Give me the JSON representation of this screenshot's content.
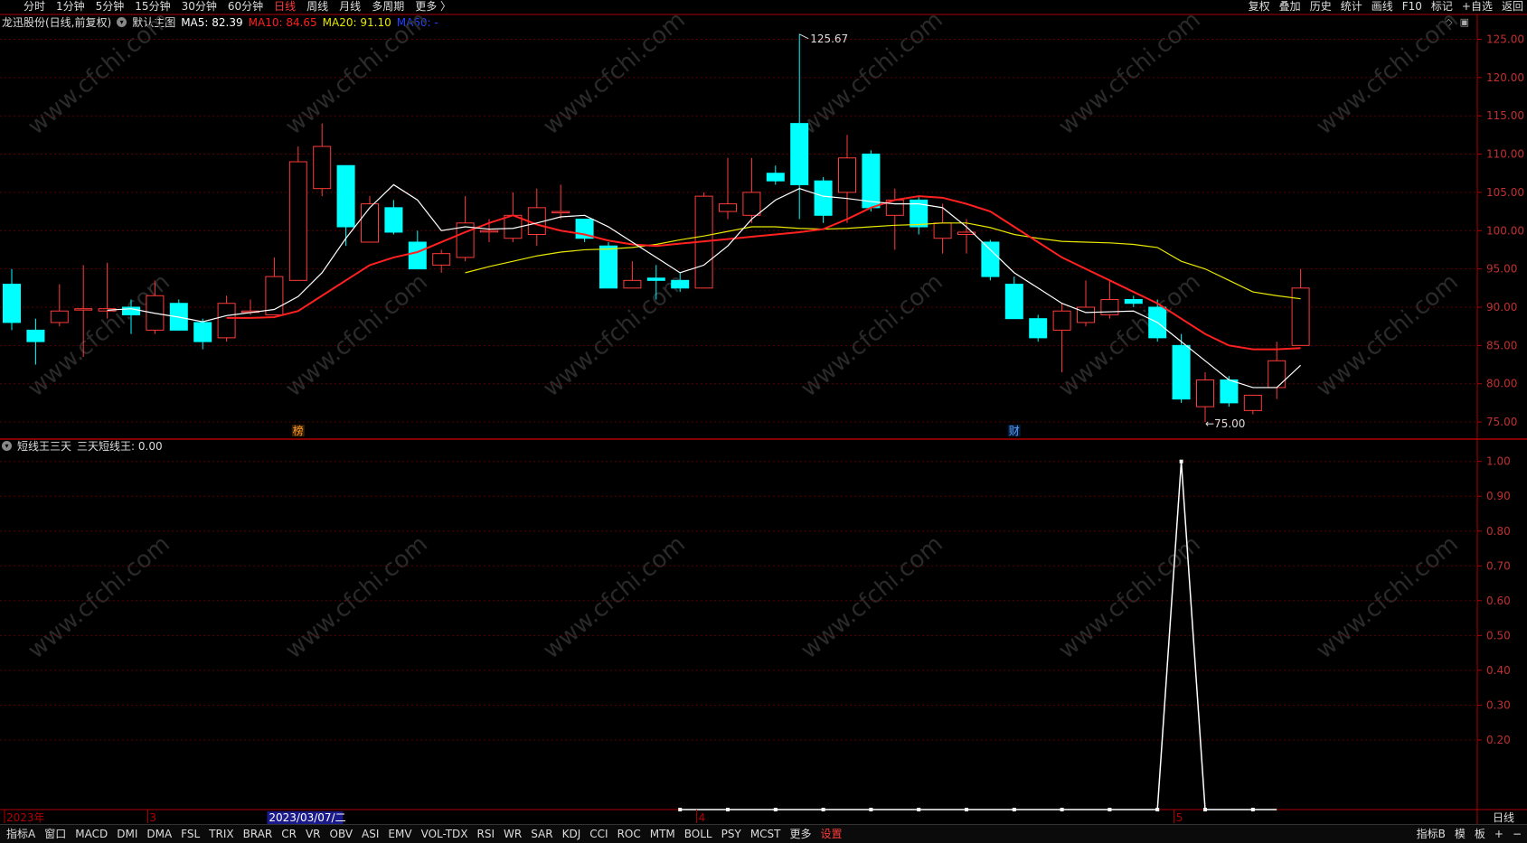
{
  "top_periods": [
    "分时",
    "1分钟",
    "5分钟",
    "15分钟",
    "30分钟",
    "60分钟",
    "日线",
    "周线",
    "月线",
    "多周期",
    "更多 〉"
  ],
  "active_period_index": 6,
  "top_tools": [
    "复权",
    "叠加",
    "历史",
    "统计",
    "画线",
    "F10",
    "标记",
    "+自选",
    "返回"
  ],
  "main_info": {
    "stock": "龙迅股份(日线,前复权)",
    "mode": "默认主图",
    "ma5": "MA5: 82.39",
    "ma10": "MA10: 84.65",
    "ma20": "MA20: 91.10",
    "ma60": "MA60: -"
  },
  "sub_info": {
    "name": "短线王三天",
    "value": "三天短线王: 0.00"
  },
  "colors": {
    "up": "#ff3b3b",
    "down": "#00ffff",
    "ma5": "#ffffff",
    "ma10": "#ff2020",
    "ma20": "#e8e800",
    "ma60": "#2244ff",
    "grid": "#5a0000",
    "axis": "#b00000"
  },
  "chart_data": [
    {
      "type": "candlestick",
      "ylim": [
        73,
        126
      ],
      "y_ticks": [
        "125.00",
        "120.00",
        "115.00",
        "110.00",
        "105.00",
        "100.00",
        "95.00",
        "90.00",
        "85.00",
        "80.00",
        "75.00"
      ],
      "candles": [
        {
          "o": 93.0,
          "h": 95.0,
          "l": 87.0,
          "c": 88.0
        },
        {
          "o": 87.0,
          "h": 88.5,
          "l": 82.5,
          "c": 85.5
        },
        {
          "o": 88.0,
          "h": 93.0,
          "l": 87.5,
          "c": 89.5
        },
        {
          "o": 89.8,
          "h": 95.5,
          "l": 83.5,
          "c": 89.8
        },
        {
          "o": 89.5,
          "h": 95.8,
          "l": 88.5,
          "c": 89.8
        },
        {
          "o": 90.0,
          "h": 91.0,
          "l": 86.5,
          "c": 89.0
        },
        {
          "o": 87.0,
          "h": 93.5,
          "l": 86.5,
          "c": 91.5
        },
        {
          "o": 90.5,
          "h": 91.0,
          "l": 87.0,
          "c": 87.0
        },
        {
          "o": 88.0,
          "h": 88.5,
          "l": 84.5,
          "c": 85.5
        },
        {
          "o": 86.0,
          "h": 91.5,
          "l": 85.5,
          "c": 90.5
        },
        {
          "o": 89.5,
          "h": 91.0,
          "l": 89.0,
          "c": 89.5
        },
        {
          "o": 89.0,
          "h": 96.5,
          "l": 89.0,
          "c": 94.0
        },
        {
          "o": 93.5,
          "h": 111.0,
          "l": 93.5,
          "c": 109.0
        },
        {
          "o": 105.5,
          "h": 114.0,
          "l": 104.5,
          "c": 111.0
        },
        {
          "o": 108.5,
          "h": 108.5,
          "l": 98.0,
          "c": 100.5
        },
        {
          "o": 98.5,
          "h": 104.5,
          "l": 98.5,
          "c": 103.5
        },
        {
          "o": 103.0,
          "h": 104.0,
          "l": 99.5,
          "c": 99.8
        },
        {
          "o": 98.5,
          "h": 100.0,
          "l": 95.0,
          "c": 95.0
        },
        {
          "o": 95.5,
          "h": 97.5,
          "l": 94.5,
          "c": 97.0
        },
        {
          "o": 96.5,
          "h": 104.5,
          "l": 96.0,
          "c": 101.0
        },
        {
          "o": 100.0,
          "h": 101.5,
          "l": 98.5,
          "c": 100.0
        },
        {
          "o": 99.0,
          "h": 105.0,
          "l": 98.5,
          "c": 102.0
        },
        {
          "o": 99.5,
          "h": 105.5,
          "l": 98.0,
          "c": 103.0
        },
        {
          "o": 102.5,
          "h": 106.0,
          "l": 101.5,
          "c": 102.5
        },
        {
          "o": 101.5,
          "h": 101.5,
          "l": 98.5,
          "c": 99.0
        },
        {
          "o": 98.0,
          "h": 98.5,
          "l": 92.5,
          "c": 92.5
        },
        {
          "o": 92.5,
          "h": 96.0,
          "l": 92.5,
          "c": 93.5
        },
        {
          "o": 93.8,
          "h": 95.5,
          "l": 91.0,
          "c": 93.5
        },
        {
          "o": 93.5,
          "h": 94.5,
          "l": 92.0,
          "c": 92.5
        },
        {
          "o": 92.5,
          "h": 105.0,
          "l": 92.5,
          "c": 104.5
        },
        {
          "o": 102.5,
          "h": 109.5,
          "l": 101.5,
          "c": 103.5
        },
        {
          "o": 102.0,
          "h": 109.5,
          "l": 101.0,
          "c": 105.0
        },
        {
          "o": 107.5,
          "h": 108.5,
          "l": 106.0,
          "c": 106.5
        },
        {
          "o": 114.0,
          "h": 125.67,
          "l": 101.5,
          "c": 106.0
        },
        {
          "o": 106.5,
          "h": 107.0,
          "l": 101.0,
          "c": 102.0
        },
        {
          "o": 105.0,
          "h": 112.5,
          "l": 101.0,
          "c": 109.5
        },
        {
          "o": 110.0,
          "h": 110.5,
          "l": 102.5,
          "c": 103.0
        },
        {
          "o": 102.0,
          "h": 105.5,
          "l": 97.5,
          "c": 104.0
        },
        {
          "o": 104.0,
          "h": 104.5,
          "l": 99.5,
          "c": 100.5
        },
        {
          "o": 99.0,
          "h": 103.5,
          "l": 97.0,
          "c": 101.0
        },
        {
          "o": 99.5,
          "h": 101.5,
          "l": 97.0,
          "c": 99.8
        },
        {
          "o": 98.5,
          "h": 98.8,
          "l": 93.5,
          "c": 94.0
        },
        {
          "o": 93.0,
          "h": 94.0,
          "l": 88.5,
          "c": 88.5
        },
        {
          "o": 88.5,
          "h": 89.0,
          "l": 85.5,
          "c": 86.0
        },
        {
          "o": 87.0,
          "h": 90.5,
          "l": 81.5,
          "c": 89.5
        },
        {
          "o": 88.0,
          "h": 93.5,
          "l": 87.5,
          "c": 90.0
        },
        {
          "o": 89.0,
          "h": 93.5,
          "l": 88.5,
          "c": 91.0
        },
        {
          "o": 91.0,
          "h": 91.5,
          "l": 90.0,
          "c": 90.5
        },
        {
          "o": 90.0,
          "h": 91.0,
          "l": 85.5,
          "c": 86.0
        },
        {
          "o": 85.0,
          "h": 86.5,
          "l": 77.5,
          "c": 78.0
        },
        {
          "o": 77.0,
          "h": 81.5,
          "l": 75.0,
          "c": 80.5
        },
        {
          "o": 80.5,
          "h": 81.0,
          "l": 77.0,
          "c": 77.5
        },
        {
          "o": 76.5,
          "h": 78.5,
          "l": 76.0,
          "c": 78.5
        },
        {
          "o": 79.5,
          "h": 85.5,
          "l": 78.0,
          "c": 83.0
        },
        {
          "o": 85.0,
          "h": 95.0,
          "l": 85.0,
          "c": 92.5
        }
      ],
      "ma5": [
        null,
        null,
        null,
        null,
        89.6,
        89.8,
        89.2,
        88.7,
        88.1,
        88.9,
        89.3,
        89.7,
        91.4,
        94.5,
        99.0,
        103.0,
        106.0,
        104.0,
        100.0,
        100.5,
        100.2,
        100.3,
        101.0,
        101.8,
        102.0,
        100.5,
        98.5,
        96.5,
        94.5,
        95.5,
        98.0,
        101.5,
        104.0,
        105.5,
        104.5,
        104.2,
        103.8,
        103.5,
        103.5,
        103.0,
        100.5,
        97.5,
        94.5,
        92.5,
        90.5,
        89.3,
        89.4,
        89.5,
        88.0,
        85.5,
        83.0,
        80.5,
        79.5,
        79.5,
        82.4
      ],
      "ma10": [
        null,
        null,
        null,
        null,
        null,
        null,
        null,
        null,
        null,
        88.6,
        88.6,
        88.7,
        89.5,
        91.5,
        93.5,
        95.5,
        96.5,
        97.2,
        98.5,
        99.8,
        101.0,
        102.0,
        100.8,
        100.0,
        99.5,
        98.7,
        98.2,
        98.0,
        98.3,
        98.6,
        98.9,
        99.2,
        99.5,
        99.8,
        100.2,
        101.5,
        103.0,
        104.0,
        104.5,
        104.3,
        103.5,
        102.5,
        100.5,
        98.5,
        96.5,
        95.0,
        93.5,
        92.0,
        90.5,
        88.5,
        86.5,
        85.0,
        84.5,
        84.5,
        84.65
      ],
      "ma20": [
        null,
        null,
        null,
        null,
        null,
        null,
        null,
        null,
        null,
        null,
        null,
        null,
        null,
        null,
        null,
        null,
        null,
        null,
        null,
        94.5,
        95.3,
        96.0,
        96.7,
        97.2,
        97.5,
        97.6,
        97.8,
        98.2,
        98.8,
        99.3,
        99.9,
        100.5,
        100.5,
        100.3,
        100.2,
        100.3,
        100.5,
        100.7,
        100.8,
        101.0,
        101.0,
        100.4,
        99.5,
        99.0,
        98.6,
        98.5,
        98.4,
        98.2,
        97.8,
        96.0,
        95.0,
        93.5,
        92.0,
        91.5,
        91.1
      ],
      "annotations": [
        {
          "text": "125.67",
          "candle": 33,
          "price": 125.67,
          "dir": "right"
        },
        {
          "text": "75.00",
          "candle": 50,
          "price": 75.0,
          "dir": "left"
        }
      ],
      "markers": [
        {
          "text": "榜",
          "candle": 12
        },
        {
          "text": "财",
          "candle": 42
        }
      ]
    },
    {
      "type": "line",
      "name": "三天短线王",
      "ylim": [
        0,
        1.02
      ],
      "y_ticks": [
        "1.00",
        "0.90",
        "0.80",
        "0.70",
        "0.60",
        "0.50",
        "0.40",
        "0.30",
        "0.20"
      ],
      "start_candle": 29,
      "values": [
        0,
        0,
        0,
        0,
        0,
        0,
        0,
        0,
        0,
        0,
        0,
        0,
        0,
        0,
        0,
        0,
        0,
        0,
        0,
        0,
        0,
        1,
        0,
        0,
        0,
        0
      ]
    }
  ],
  "x_axis_labels": [
    {
      "text": "2023年",
      "candle": 0,
      "color": "#b00000"
    },
    {
      "text": "3",
      "candle": 6,
      "color": "#b00000"
    },
    {
      "text": "2023/03/07/二",
      "candle": 11,
      "highlight": true
    },
    {
      "text": "4",
      "candle": 29,
      "color": "#b00000"
    },
    {
      "text": "5",
      "candle": 49,
      "color": "#b00000"
    }
  ],
  "bottom_tabs": [
    "指标A",
    "窗口",
    "MACD",
    "DMI",
    "DMA",
    "FSL",
    "TRIX",
    "BRAR",
    "CR",
    "VR",
    "OBV",
    "ASI",
    "EMV",
    "VOL-TDX",
    "RSI",
    "WR",
    "SAR",
    "KDJ",
    "CCI",
    "ROC",
    "MTM",
    "BOLL",
    "PSY",
    "MCST",
    "更多",
    "设置"
  ],
  "bottom_right": [
    "指标B",
    "模",
    "板",
    "+",
    "−"
  ],
  "day_label": "日线",
  "watermark": "www.cfchi.com"
}
